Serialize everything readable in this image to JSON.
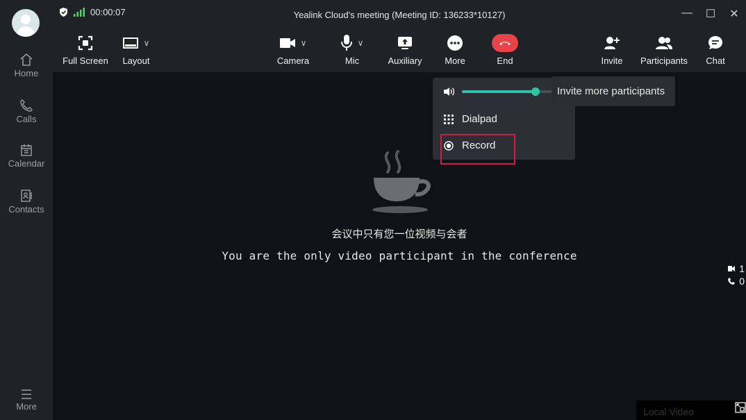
{
  "sidebar": {
    "items": [
      {
        "label": "Home",
        "icon": "home-icon"
      },
      {
        "label": "Calls",
        "icon": "phone-icon"
      },
      {
        "label": "Calendar",
        "icon": "calendar-icon"
      },
      {
        "label": "Contacts",
        "icon": "contacts-icon"
      }
    ],
    "more_label": "More"
  },
  "titlebar": {
    "timer": "00:00:07",
    "title": "Yealink Cloud's meeting  (Meeting ID: 136233*10127)"
  },
  "toolbar": {
    "fullscreen": "Full Screen",
    "layout": "Layout",
    "camera": "Camera",
    "mic": "Mic",
    "auxiliary": "Auxiliary",
    "more": "More",
    "end": "End",
    "invite": "Invite",
    "participants": "Participants",
    "chat": "Chat"
  },
  "main": {
    "message_cn": "会议中只有您一位视频与会者",
    "message_en": "You are the only video participant in the conference"
  },
  "more_menu": {
    "volume_level": 0.73,
    "dialpad": "Dialpad",
    "record": "Record"
  },
  "tooltip": "Invite more participants",
  "counts": {
    "video": "1",
    "audio": "0"
  },
  "local_video": "Local Video",
  "colors": {
    "accent": "#2fc3a8",
    "end": "#e8424a",
    "highlight": "#d01f3c"
  }
}
